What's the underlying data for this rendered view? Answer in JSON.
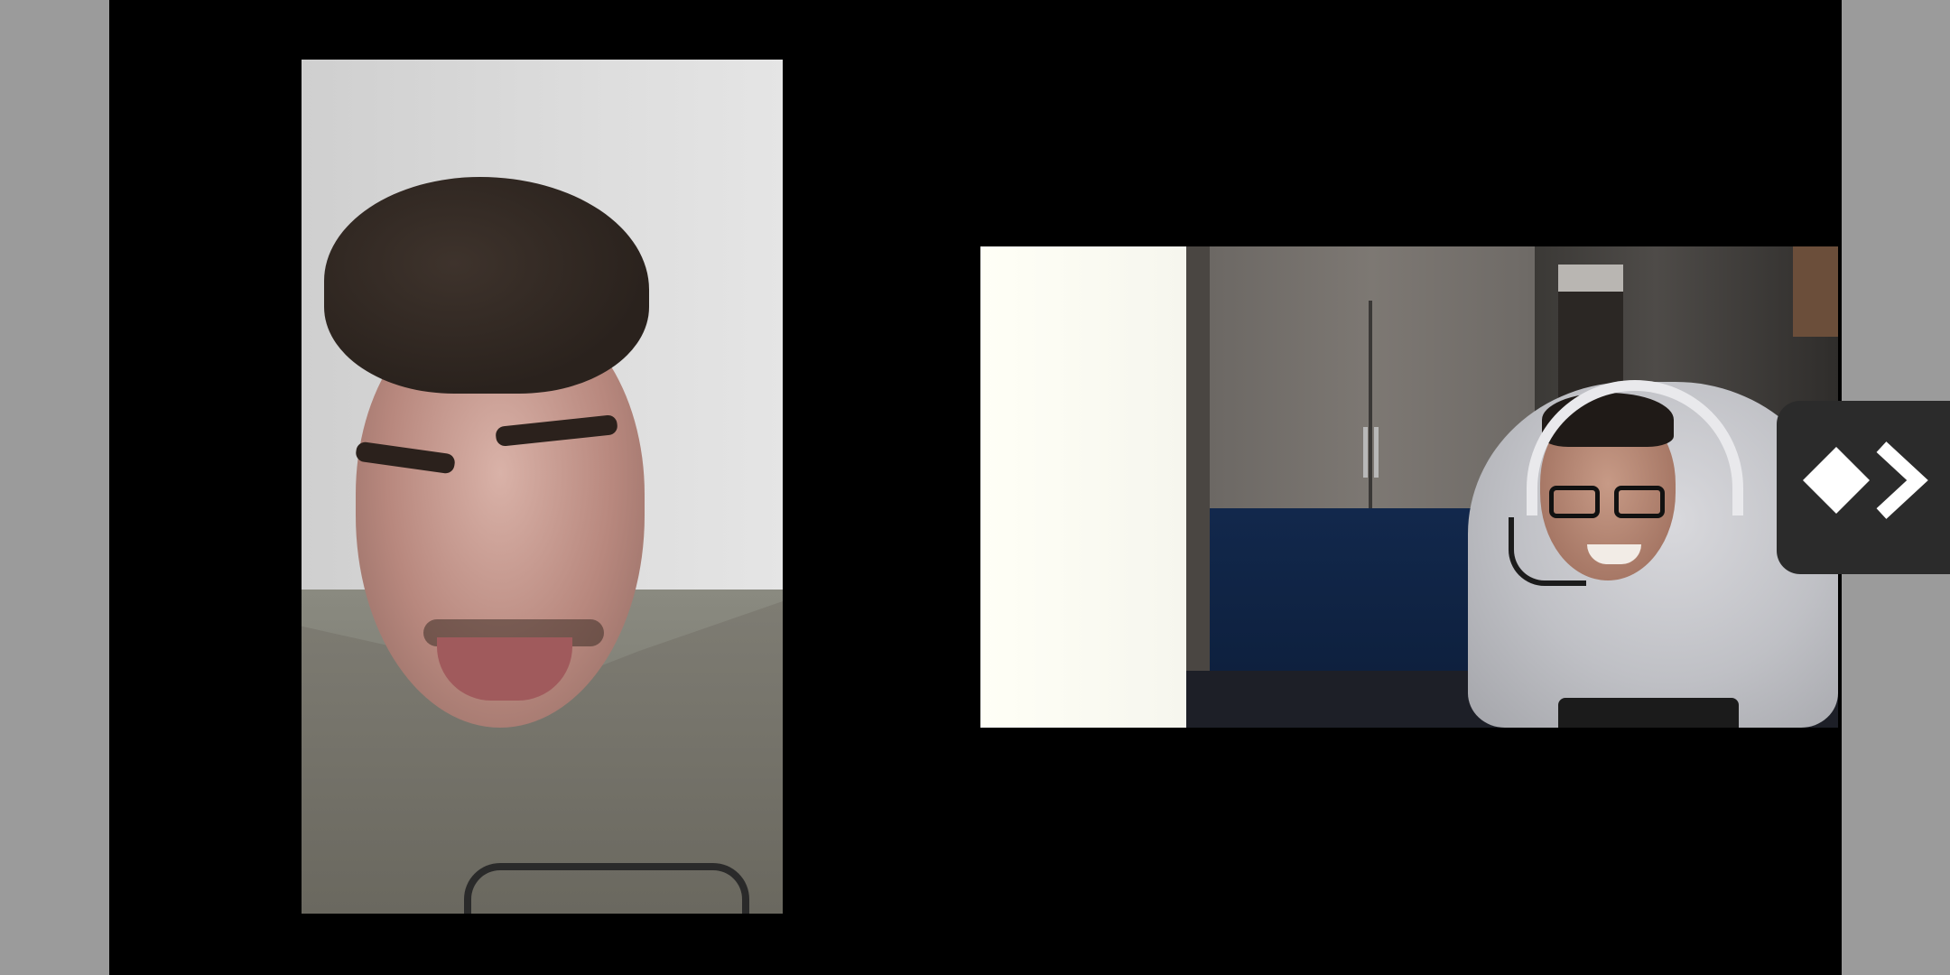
{
  "app": {
    "screen": "video-call",
    "background_color": "#9b9b9b",
    "stage_color": "#000000"
  },
  "participants": [
    {
      "role": "remote",
      "orientation": "portrait"
    },
    {
      "role": "local",
      "orientation": "landscape"
    }
  ],
  "controls": {
    "floating_button": {
      "icon": "diamond-forward-icon",
      "background": "#2b2b2b",
      "accent": "#ffffff"
    }
  }
}
